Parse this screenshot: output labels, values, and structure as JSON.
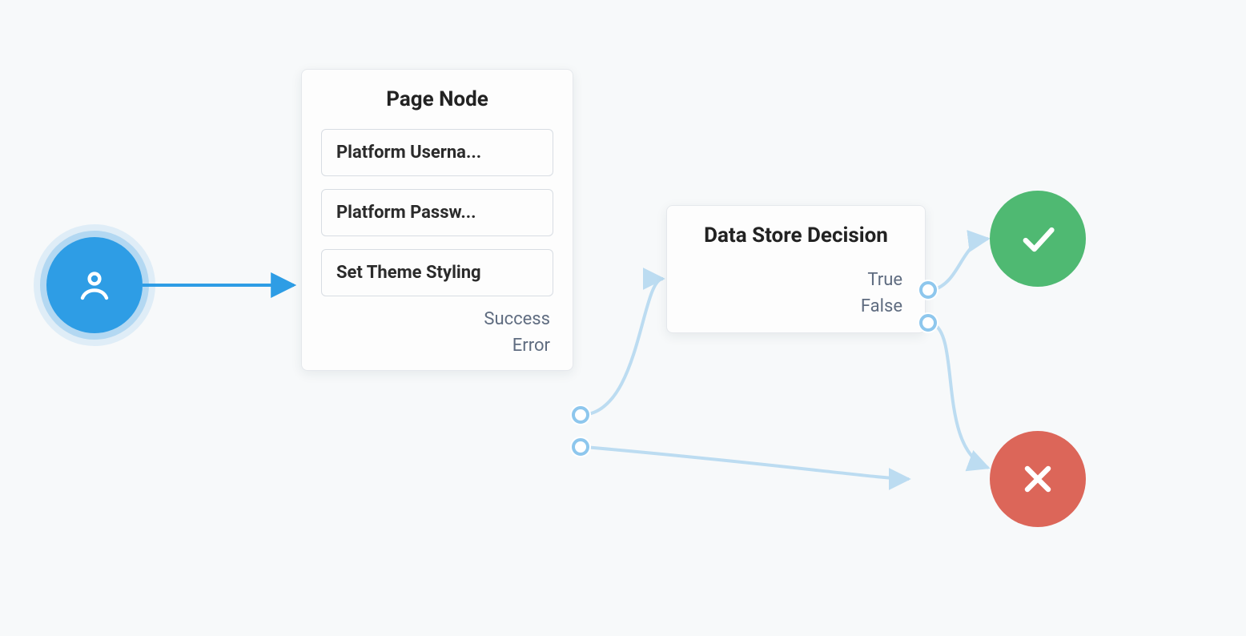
{
  "colors": {
    "start": "#2e9de5",
    "success": "#4fb972",
    "failure": "#dc6659",
    "connector": "#bcdcf1",
    "port_ring": "#8ec7ed"
  },
  "start_node": {
    "icon": "user-icon"
  },
  "page_node": {
    "title": "Page Node",
    "items": [
      "Platform Userna...",
      "Platform Passw...",
      "Set Theme Styling"
    ],
    "outcomes": [
      {
        "label": "Success"
      },
      {
        "label": "Error"
      }
    ]
  },
  "decision_node": {
    "title": "Data Store Decision",
    "outcomes": [
      {
        "label": "True"
      },
      {
        "label": "False"
      }
    ]
  },
  "end_success": {
    "icon": "check-icon"
  },
  "end_failure": {
    "icon": "x-icon"
  }
}
